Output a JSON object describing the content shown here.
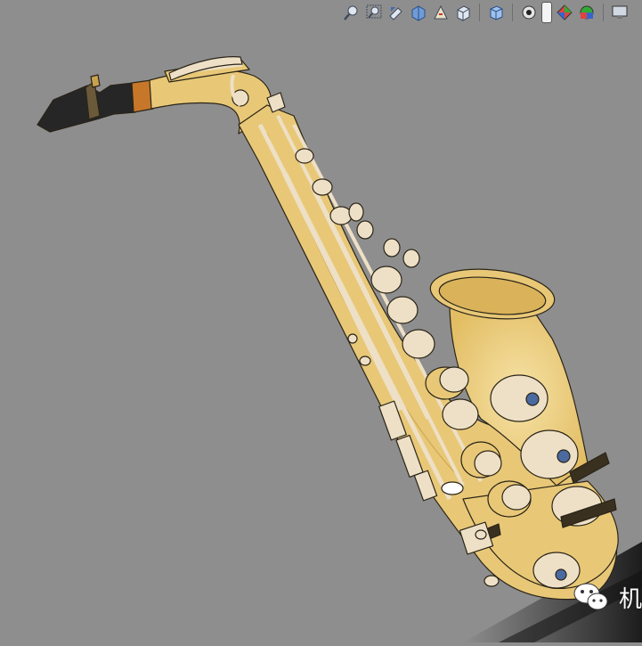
{
  "app": {
    "background": "#8e8e8e"
  },
  "toolbar": {
    "buttons": [
      {
        "name": "zoom-to-fit-button",
        "icon": "zoom-to-fit-icon"
      },
      {
        "name": "zoom-to-area-button",
        "icon": "zoom-area-icon"
      },
      {
        "name": "previous-view-button",
        "icon": "previous-view-icon"
      },
      {
        "name": "section-view-button",
        "icon": "section-view-icon"
      },
      {
        "name": "dynamic-annotation-button",
        "icon": "annotation-views-icon"
      },
      {
        "name": "view-orientation-button",
        "icon": "view-orientation-icon"
      },
      {
        "name": "display-style-button",
        "icon": "display-style-icon"
      },
      {
        "name": "hide-show-items-button",
        "icon": "hide-show-icon"
      },
      {
        "name": "edit-appearance-button",
        "icon": "edit-appearance-icon"
      },
      {
        "name": "apply-scene-button",
        "icon": "scene-icon"
      },
      {
        "name": "view-settings-button",
        "icon": "monitor-icon"
      }
    ]
  },
  "model": {
    "name": "saxophone",
    "colors": {
      "brass": "#e8c877",
      "brass_dark": "#c9a24e",
      "key": "#eee0c6",
      "mouthpiece": "#262626",
      "outline": "#2a2418"
    }
  },
  "watermark": {
    "text": "机",
    "icon": "wechat-icon"
  }
}
